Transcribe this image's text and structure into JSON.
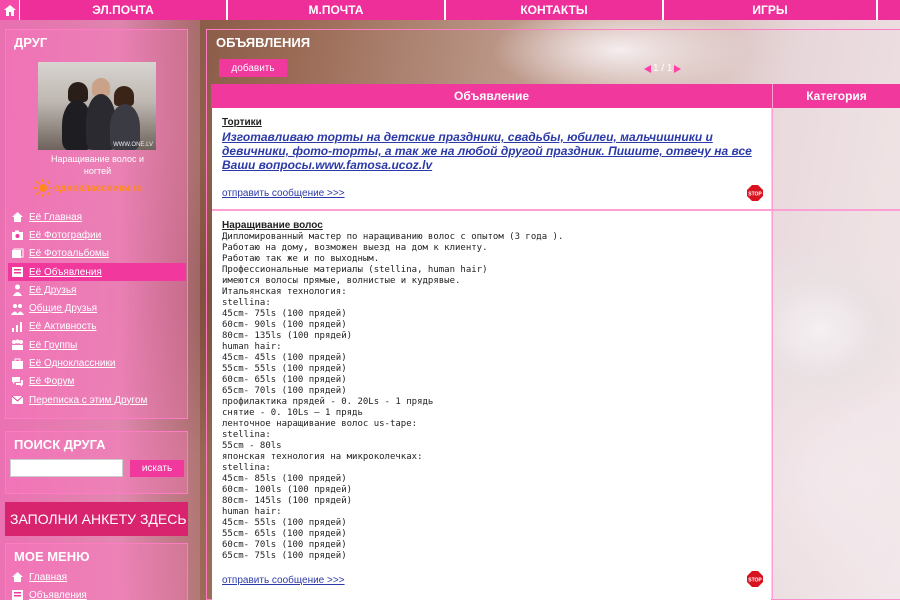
{
  "nav": {
    "items": [
      "ЭЛ.ПОЧТА",
      "М.ПОЧТА",
      "КОНТАКТЫ",
      "ИГРЫ"
    ]
  },
  "friend": {
    "panel_title": "ДРУГ",
    "photo_caption": "WWW.ONE.LV",
    "name_line1": "Наращивание волос и",
    "name_line2": "ногтей",
    "logo_text": "одноклассники.ru"
  },
  "friend_menu": [
    {
      "label": "Её Главная",
      "icon": "home-icon"
    },
    {
      "label": "Её Фотографии",
      "icon": "camera-icon"
    },
    {
      "label": "Её Фотоальбомы",
      "icon": "album-icon"
    },
    {
      "label": "Её Объявления",
      "icon": "ads-icon",
      "active": true
    },
    {
      "label": "Её Друзья",
      "icon": "person-icon"
    },
    {
      "label": "Общие Друзья",
      "icon": "people-icon"
    },
    {
      "label": "Её Активность",
      "icon": "activity-icon"
    },
    {
      "label": "Её Группы",
      "icon": "groups-icon"
    },
    {
      "label": "Её Одноклассники",
      "icon": "classmates-icon"
    },
    {
      "label": "Её Форум",
      "icon": "forum-icon"
    },
    {
      "label": "Переписка с этим Другом",
      "icon": "chat-icon"
    }
  ],
  "search": {
    "title": "ПОИСК ДРУГА",
    "input_value": "",
    "button_label": "искать"
  },
  "banner": {
    "text": "ЗАПОЛНИ АНКЕТУ ЗДЕСЬ"
  },
  "my_menu": {
    "title": "МОЕ МЕНЮ",
    "items": [
      "Главная",
      "Объявления"
    ]
  },
  "main": {
    "title": "ОБЪЯВЛЕНИЯ",
    "add_button": "добавить",
    "pager": "1 / 1",
    "col_ad": "Объявление",
    "col_category": "Категория"
  },
  "ads": [
    {
      "title": "Тортики",
      "link_text": "Изготавливаю торты на детские праздники, свадьбы, юбилеи, мальчишники и девичники, фото-торты, а так же на любой другой праздник. Пишите, отвечу на все Ваши вопросы.www.famosa.ucoz.lv",
      "send_label": "отправить сообщение >>>"
    },
    {
      "title": "Наращивание волос",
      "body": "Дипломированный мастер по наращиванию волос с опытом (3 года ).\nРаботаю на дому, возможен выезд на дом к клиенту.\nРаботаю так же и по выходным.\nПрофессиональные материалы (stellina, human hair)\nимеются волосы прямые, волнистые и кудрявые.\nИтальянская технология:\nstellina:\n45cm- 75ls (100 прядей)\n60cm- 90ls (100 прядей)\n80cm- 135ls (100 прядей)\nhuman hair:\n45cm- 45ls (100 прядей)\n55cm- 55ls (100 прядей)\n60cm- 65ls (100 прядей)\n65cm- 70ls (100 прядей)\nпрофилактика прядей - 0. 20Ls - 1 прядь\nснятие - 0. 10Ls – 1 прядь\nленточное наращивание волос us-tape:\nstellina:\n55cm - 80ls\nяпонская технология на микроколечках:\nstellina:\n45cm- 85ls (100 прядей)\n60cm- 100ls (100 прядей)\n80cm- 145ls (100 прядей)\nhuman hair:\n45cm- 55ls (100 прядей)\n55cm- 65ls (100 прядей)\n60cm- 70ls (100 прядей)\n65cm- 75ls (100 прядей)",
      "send_label": "отправить сообщение >>>"
    }
  ],
  "colors": {
    "accent": "#f0389d",
    "link": "#2b3aa8",
    "nav": "#ee2f9a"
  }
}
